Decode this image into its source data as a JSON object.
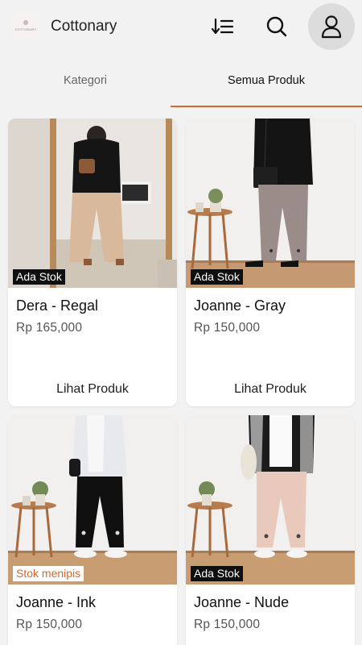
{
  "app": {
    "title": "Cottonary",
    "logo_text": "COTTONARY"
  },
  "header": {
    "icons": [
      "sort-icon",
      "search-icon",
      "account-icon"
    ]
  },
  "tabs": [
    {
      "label": "Kategori",
      "active": false
    },
    {
      "label": "Semua Produk",
      "active": true
    }
  ],
  "colors": {
    "accent": "#d9672a",
    "background": "#f2f2f2",
    "badge_dark": "#0f0f0f"
  },
  "products": [
    {
      "name": "Dera - Regal",
      "price": "Rp 165,000",
      "stock": "Ada Stok",
      "action": "Lihat Produk"
    },
    {
      "name": "Joanne - Gray",
      "price": "Rp 150,000",
      "stock": "Ada Stok",
      "action": "Lihat Produk"
    },
    {
      "name": "Joanne - Ink",
      "price": "Rp 150,000",
      "stock": "Stok menipis"
    },
    {
      "name": "Joanne - Nude",
      "price": "Rp 150,000",
      "stock": "Ada Stok"
    }
  ]
}
